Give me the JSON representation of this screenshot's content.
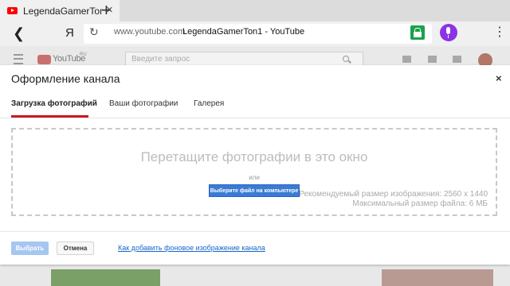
{
  "browser": {
    "tab_title": "LegendaGamerTon1 - YouTube",
    "close_tab": "×",
    "new_tab": "+",
    "yandex_label": "Я",
    "url_domain": "www.youtube.com",
    "page_title": "LegendaGamerTon1 - YouTube",
    "colors": {
      "lock": "#19a24b",
      "voice": "#8b33e6"
    }
  },
  "youtube": {
    "wordmark": "YouTube",
    "region": "RU",
    "search_placeholder": "Введите запрос"
  },
  "modal": {
    "title": "Оформление канала",
    "close": "×",
    "tabs": [
      {
        "label": "Загрузка фотографий",
        "active": true
      },
      {
        "label": "Ваши фотографии",
        "active": false
      },
      {
        "label": "Галерея",
        "active": false
      }
    ],
    "dropzone": {
      "main_text": "Перетащите фотографии в это окно",
      "or_text": "или",
      "choose_button": "Выберите файл на компьютере",
      "recommended_size": "Рекомендуемый размер изображения: 2560 х 1440",
      "max_size": "Максимальный размер файла: 6 МБ"
    },
    "footer": {
      "select_button": "Выбрать",
      "cancel_button": "Отмена",
      "help_link": "Как добавить фоновое изображение канала"
    }
  }
}
